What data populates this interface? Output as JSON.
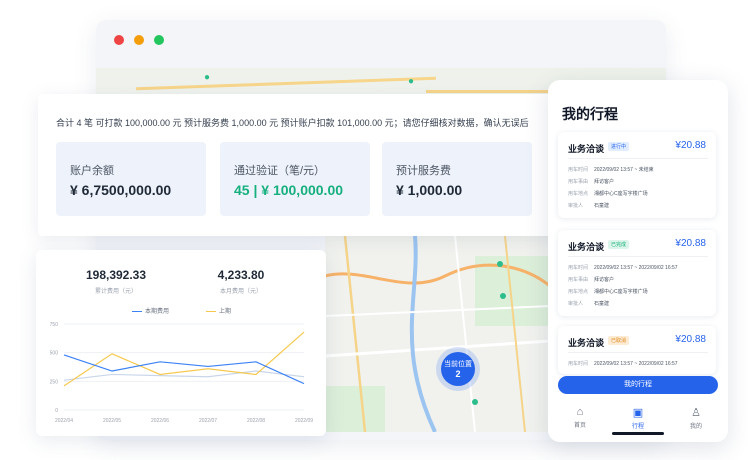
{
  "browser": {
    "map_pins": [
      "",
      ""
    ]
  },
  "summary": {
    "line": "合计 4 笔  可打款 100,000.00 元  预计服务费 1,000.00 元  预计账户扣款 101,000.00 元；请您仔细核对数据，确认无误后",
    "cards": [
      {
        "label": "账户余额",
        "value": "¥ 6,7500,000.00"
      },
      {
        "label": "通过验证（笔/元）",
        "value": "45 | ¥ 100,000.00"
      },
      {
        "label": "预计服务费",
        "value": "¥ 1,000.00"
      }
    ]
  },
  "chart_card": {
    "metrics": [
      {
        "value": "198,392.33",
        "label": "累计费用（元）"
      },
      {
        "value": "4,233.80",
        "label": "本月费用（元）"
      }
    ],
    "legend": [
      "本期费用",
      "上期"
    ]
  },
  "chart_data": {
    "type": "line",
    "categories": [
      "2022/04",
      "2022/05",
      "2022/06",
      "2022/07",
      "2022/08",
      "2022/09"
    ],
    "yticks": [
      "750",
      "500",
      "250",
      "0"
    ],
    "ylim": [
      0,
      750
    ],
    "series": [
      {
        "name": "本期费用",
        "color": "#3b82f6",
        "values": [
          480,
          340,
          420,
          380,
          420,
          230
        ]
      },
      {
        "name": "上期",
        "color": "#f6c94e",
        "values": [
          210,
          490,
          310,
          360,
          310,
          680
        ]
      },
      {
        "name": "上期",
        "color": "#c9d6ea",
        "values": [
          260,
          310,
          300,
          290,
          340,
          290
        ]
      }
    ],
    "colors": {
      "blue": "#3b82f6",
      "yellow": "#f6c94e"
    }
  },
  "map": {
    "cluster_label": "当前位置",
    "cluster_count": "2"
  },
  "phone": {
    "title": "我的行程",
    "trips": [
      {
        "name": "业务洽谈",
        "badge": "进行中",
        "badge_color": "blue",
        "price": "¥20.88",
        "rows": [
          {
            "k": "用车时间",
            "v": "2022/09/02 13:57 ~ 未结束"
          },
          {
            "k": "用车事由",
            "v": "拜访客户"
          },
          {
            "k": "用车地点",
            "v": "湘都中心C座写字楼广场"
          },
          {
            "k": "审批人",
            "v": "石童建"
          }
        ]
      },
      {
        "name": "业务洽谈",
        "badge": "已完成",
        "badge_color": "green",
        "price": "¥20.88",
        "rows": [
          {
            "k": "用车时间",
            "v": "2022/09/02 13:57 ~ 2022/09/02 16:57"
          },
          {
            "k": "用车事由",
            "v": "拜访客户"
          },
          {
            "k": "用车地点",
            "v": "湘都中心C座写字楼广场"
          },
          {
            "k": "审批人",
            "v": "石童建"
          }
        ]
      },
      {
        "name": "业务洽谈",
        "badge": "已取消",
        "badge_color": "orange",
        "price": "¥20.88",
        "rows": [
          {
            "k": "用车时间",
            "v": "2022/09/02 13:57 ~ 2022/09/02 16:57"
          }
        ]
      }
    ],
    "button": "我的行程",
    "tabs": [
      {
        "icon": "⌂",
        "label": "首页"
      },
      {
        "icon": "▣",
        "label": "行程"
      },
      {
        "icon": "♙",
        "label": "我的"
      }
    ]
  }
}
